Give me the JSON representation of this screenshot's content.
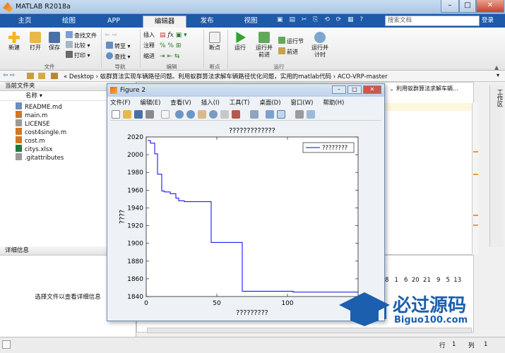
{
  "window": {
    "title": "MATLAB R2018a",
    "minimize": "–",
    "maximize": "□",
    "close": "✕"
  },
  "tabs": [
    {
      "label": "主页"
    },
    {
      "label": "绘图"
    },
    {
      "label": "APP"
    },
    {
      "label": "编辑器"
    },
    {
      "label": "发布"
    },
    {
      "label": "视图"
    }
  ],
  "search": {
    "placeholder": "搜索文档",
    "login": "登录"
  },
  "ribbon": {
    "new": "新建",
    "open": "打开",
    "save": "保存",
    "find_files": "查找文件",
    "compare": "比较",
    "print": "打印",
    "goto": "转至",
    "find": "查找",
    "insert": "插入",
    "fx": "fx",
    "comment": "注释",
    "indent": "缩进",
    "breakpoints": "断点",
    "run": "运行",
    "run_advance_1": "运行并",
    "run_advance_2": "前进",
    "run_section": "运行节",
    "advance": "前进",
    "run_time_1": "运行并",
    "run_time_2": "计时",
    "groups": {
      "file": "文件",
      "nav": "导航",
      "edit": "编辑",
      "breakpoints": "断点",
      "run": "运行"
    }
  },
  "address": {
    "path": "« Desktop › 蚁群算法实现车辆路径问题。利用蚁群算法求解车辆路径优化问题，实用的matlab代码 › ACO-VRP-master"
  },
  "left_panel": {
    "header": "当前文件夹",
    "column": "名称 ▾",
    "files": [
      {
        "name": "README.md",
        "color": "#6b8fbf"
      },
      {
        "name": "main.m",
        "color": "#d8751f"
      },
      {
        "name": "LICENSE",
        "color": "#9a9a9a"
      },
      {
        "name": "cost4single.m",
        "color": "#d8751f"
      },
      {
        "name": "cost.m",
        "color": "#d8751f"
      },
      {
        "name": "citys.xlsx",
        "color": "#1f7a3a"
      },
      {
        "name": ".gitattributes",
        "color": "#9a9a9a"
      }
    ],
    "details_header": "详细信息",
    "details_text": "选择文件以查看详细信息"
  },
  "right_bg": {
    "breadcrumb_tail": "。利用蚁群算法求解车辆...",
    "side_label": "工作区",
    "numbers": "8   1   6  20  21   9   5  13"
  },
  "figure": {
    "title": "Figure 2",
    "menu": [
      "文件(F)",
      "编辑(E)",
      "查看(V)",
      "插入(I)",
      "工具(T)",
      "桌面(D)",
      "窗口(W)",
      "帮助(H)"
    ]
  },
  "chart_data": {
    "type": "line",
    "title": "?????????????",
    "xlabel": "?????????",
    "ylabel": "????",
    "xlim": [
      0,
      150
    ],
    "ylim": [
      1840,
      2020
    ],
    "xticks": [
      0,
      50,
      100
    ],
    "yticks": [
      1840,
      1860,
      1880,
      1900,
      1920,
      1940,
      1960,
      1980,
      2000,
      2020
    ],
    "series": [
      {
        "name": "????????",
        "color": "#0000ff",
        "x": [
          1,
          3,
          3,
          6,
          6,
          8,
          8,
          11,
          11,
          13,
          13,
          17,
          17,
          21,
          21,
          23,
          23,
          27,
          27,
          46,
          46,
          68,
          68,
          104,
          104,
          150
        ],
        "y": [
          2016,
          2016,
          2013,
          2013,
          2001,
          2001,
          1978,
          1978,
          1959,
          1959,
          1958,
          1958,
          1956,
          1956,
          1951,
          1951,
          1948,
          1948,
          1947,
          1947,
          1901,
          1901,
          1846,
          1846,
          1845,
          1845
        ]
      }
    ]
  },
  "status": {
    "row_label": "行",
    "row": "1",
    "col_label": "列",
    "col": "1"
  },
  "watermark": {
    "cn": "必过源码",
    "url": "Biguo100.com"
  }
}
